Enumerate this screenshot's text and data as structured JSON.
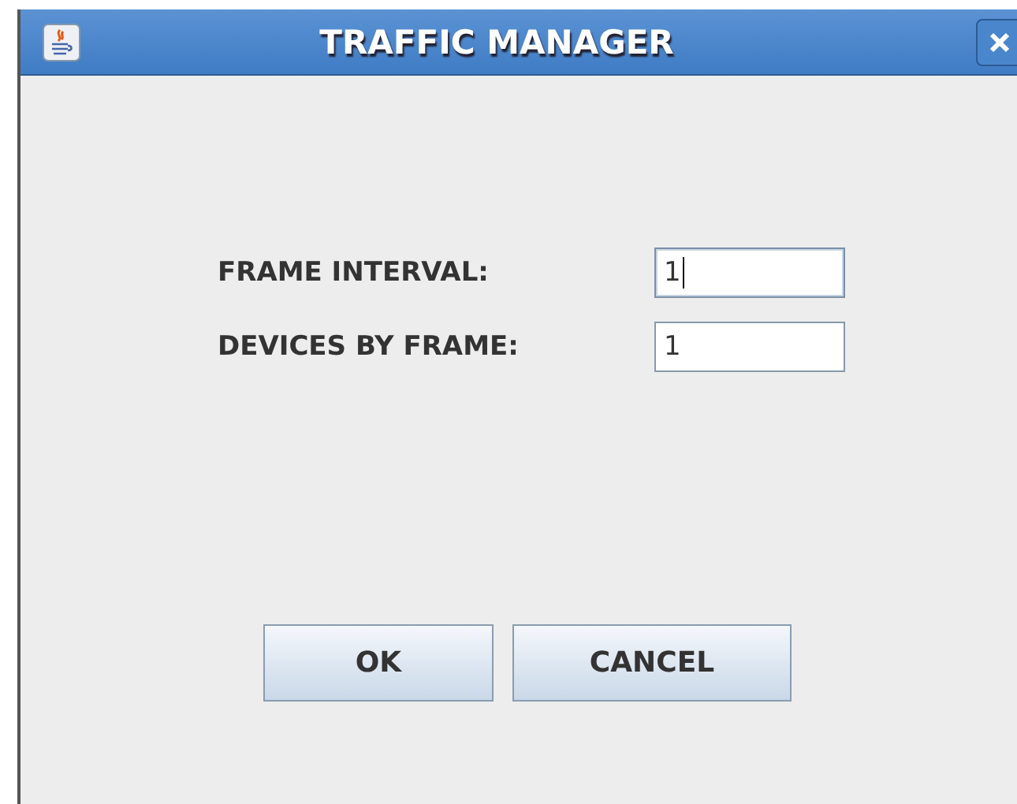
{
  "window": {
    "title": "TRAFFIC MANAGER"
  },
  "fields": [
    {
      "label": "FRAME INTERVAL:",
      "value": "1",
      "focused": true
    },
    {
      "label": "DEVICES BY FRAME:",
      "value": "1",
      "focused": false
    }
  ],
  "buttons": [
    "OK",
    "CANCEL"
  ]
}
